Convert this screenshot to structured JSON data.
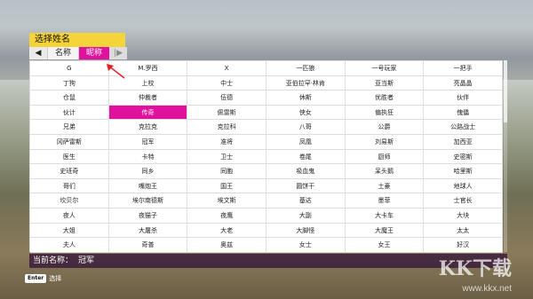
{
  "dialog": {
    "title": "选择姓名"
  },
  "tabs": [
    {
      "label": "◀",
      "kind": "arrow"
    },
    {
      "label": "名称"
    },
    {
      "label": "昵称",
      "active": true
    },
    {
      "label": "|▶",
      "kind": "arrow"
    }
  ],
  "grid": {
    "rows": [
      [
        "G",
        "M.罗西",
        "X",
        "一匹狼",
        "一号玩家",
        "一把手"
      ],
      [
        "丁狗",
        "上校",
        "中士",
        "亚伯拉罕·林肯",
        "亚当斯",
        "亮晶晶"
      ],
      [
        "仓鼠",
        "仲裁者",
        "伍德",
        "休斯",
        "优胜者",
        "伙伴"
      ],
      [
        "伙计",
        "传奇",
        "佩雷斯",
        "侠女",
        "偏执狂",
        "傀儡"
      ],
      [
        "兄弟",
        "克拉克",
        "克拉科",
        "八哥",
        "公爵",
        "公路战士"
      ],
      [
        "冈萨雷斯",
        "冠军",
        "准将",
        "凤凰",
        "刘易斯",
        "加西亚"
      ],
      [
        "医生",
        "卡特",
        "卫士",
        "卷尾",
        "厨师",
        "史密斯"
      ],
      [
        "史班奇",
        "同乡",
        "同胞",
        "吸血鬼",
        "呆头鹅",
        "哈里斯"
      ],
      [
        "哥们",
        "嘴炮王",
        "国王",
        "圆饼干",
        "土豪",
        "地球人"
      ],
      [
        "坎贝尔",
        "埃尔南德斯",
        "埃文斯",
        "基达",
        "墨菲",
        "士官长"
      ],
      [
        "夜人",
        "夜猫子",
        "夜鹰",
        "大副",
        "大卡车",
        "大块"
      ],
      [
        "大姐",
        "大屠杀",
        "大老",
        "大脚怪",
        "大魔王",
        "太太"
      ],
      [
        "夫人",
        "奇普",
        "奥兹",
        "女士",
        "女王",
        "好汉"
      ]
    ],
    "selected": {
      "row": 3,
      "col": 1
    }
  },
  "current": {
    "label": "当前名称：",
    "value": "冠军"
  },
  "footer": {
    "key": "Enter",
    "action": "选择"
  },
  "watermark": {
    "logo": "KK下载",
    "url": "www.kkx.net"
  },
  "colors": {
    "accent": "#e0119d",
    "title_bg": "#f5d33a",
    "bar_bg": "#3c1e3c"
  }
}
